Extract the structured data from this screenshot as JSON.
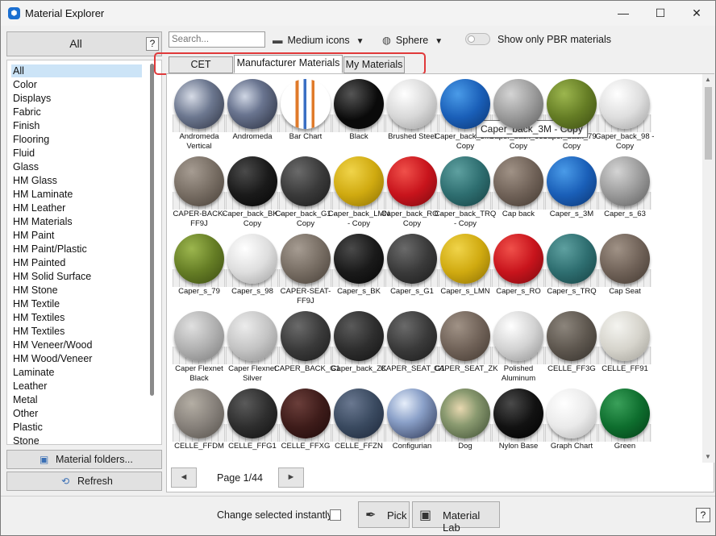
{
  "window": {
    "title": "Material Explorer",
    "logo_glyph": "⬢",
    "min_glyph": "—",
    "max_glyph": "☐",
    "close_glyph": "✕"
  },
  "left": {
    "header_label": "All",
    "help_label": "?",
    "categories": [
      "All",
      "Color",
      "Displays",
      "Fabric",
      "Finish",
      "Flooring",
      "Fluid",
      "Glass",
      "HM Glass",
      "HM Laminate",
      "HM Leather",
      "HM Materials",
      "HM Paint",
      "HM Paint/Plastic",
      "HM Painted",
      "HM Solid Surface",
      "HM Stone",
      "HM Textile",
      "HM Textiles",
      "HM Textiles",
      "HM Veneer/Wood",
      "HM Wood/Veneer",
      "Laminate",
      "Leather",
      "Metal",
      "Other",
      "Plastic",
      "Stone"
    ],
    "selected_category": "All",
    "folders_label": "Material folders...",
    "refresh_label": "Refresh"
  },
  "toolbar": {
    "search_placeholder": "Search...",
    "size_label": "Medium icons",
    "shape_label": "Sphere",
    "pbr_label": "Show only PBR materials",
    "pbr_on": false,
    "caret_glyph": "▼"
  },
  "tabs": [
    {
      "label": "CET Materials",
      "active": false
    },
    {
      "label": "Manufacturer Materials",
      "active": true
    },
    {
      "label": "My Materials",
      "active": false
    }
  ],
  "tooltip": "Caper_back_3M - Copy",
  "materials": [
    {
      "name": "Andromeda Vertical",
      "bg": "radial-gradient(circle at 35% 35%, #d6dbe6, #6d7890 45%, #2c3140)"
    },
    {
      "name": "Andromeda",
      "bg": "radial-gradient(circle at 35% 35%, #cfd6e4, #6a7590 40%, #262b3a)"
    },
    {
      "name": "Bar Chart",
      "bg": "linear-gradient(90deg, #fff 0 30%, #e07a2a 30% 36%, #fff 36% 46%, #3a6fc4 46% 52%, #fff 52% 62%, #e07a2a 62% 68%, #fff 68%)"
    },
    {
      "name": "Black",
      "bg": "radial-gradient(circle at 35% 30%, #555, #0a0a0a 55%)"
    },
    {
      "name": "Brushed Steel",
      "bg": "radial-gradient(circle at 35% 30%, #ffffff, #d8d8d8 50%, #9a9a9a)"
    },
    {
      "name": "Caper_back_3M - Copy",
      "bg": "radial-gradient(circle at 35% 30%, #4a9be8, #1a5fb8 50%, #0c3470)"
    },
    {
      "name": "Caper_back_63 - Copy",
      "bg": "radial-gradient(circle at 35% 30%, #d4d4d4, #9a9a9a 50%, #5c5c5c)"
    },
    {
      "name": "Caper_back_79 - Copy",
      "bg": "radial-gradient(circle at 35% 30%, #9cb64e, #657d25 50%, #3a4a12)"
    },
    {
      "name": "Caper_back_98 - Copy",
      "bg": "radial-gradient(circle at 35% 30%, #ffffff, #dedede 50%, #9e9e9e)"
    },
    {
      "name": "CAPER-BACK-FF9J",
      "bg": "radial-gradient(circle at 35% 30%, #a69c92, #776d63 50%, #463e37)"
    },
    {
      "name": "Caper_back_BK - Copy",
      "bg": "radial-gradient(circle at 35% 30%, #4a4a4a, #1a1a1a 50%, #050505)"
    },
    {
      "name": "Caper_back_G1 - Copy",
      "bg": "radial-gradient(circle at 35% 30%, #6a6a6a, #3a3a3a 50%, #1a1a1a)"
    },
    {
      "name": "Caper_back_LMN - Copy",
      "bg": "radial-gradient(circle at 35% 30%, #f0d44a, #d0aa10 50%, #8a6e05)"
    },
    {
      "name": "Caper_back_RO - Copy",
      "bg": "radial-gradient(circle at 35% 30%, #f0504a, #c8141c 50%, #7a0a10)"
    },
    {
      "name": "Caper_back_TRQ - Copy",
      "bg": "radial-gradient(circle at 35% 30%, #5ea0a0, #2e6e70 50%, #164042)"
    },
    {
      "name": "Cap back",
      "bg": "radial-gradient(circle at 35% 30%, #a09286, #706258 50%, #423830)"
    },
    {
      "name": "Caper_s_3M",
      "bg": "radial-gradient(circle at 35% 30%, #4a9be8, #1a5fb8 50%, #0c3470)"
    },
    {
      "name": "Caper_s_63",
      "bg": "radial-gradient(circle at 35% 30%, #d4d4d4, #9a9a9a 50%, #5c5c5c)"
    },
    {
      "name": "Caper_s_79",
      "bg": "radial-gradient(circle at 35% 30%, #9cb64e, #657d25 50%, #3a4a12)"
    },
    {
      "name": "Caper_s_98",
      "bg": "radial-gradient(circle at 35% 30%, #ffffff, #dedede 50%, #9e9e9e)"
    },
    {
      "name": "CAPER-SEAT-FF9J",
      "bg": "radial-gradient(circle at 35% 30%, #a69c92, #776d63 50%, #463e37)"
    },
    {
      "name": "Caper_s_BK",
      "bg": "radial-gradient(circle at 35% 30%, #4a4a4a, #1a1a1a 50%, #050505)"
    },
    {
      "name": "Caper_s_G1",
      "bg": "radial-gradient(circle at 35% 30%, #6a6a6a, #3a3a3a 50%, #1a1a1a)"
    },
    {
      "name": "Caper_s_LMN",
      "bg": "radial-gradient(circle at 35% 30%, #f0d44a, #d0aa10 50%, #8a6e05)"
    },
    {
      "name": "Caper_s_RO",
      "bg": "radial-gradient(circle at 35% 30%, #f0504a, #c8141c 50%, #7a0a10)"
    },
    {
      "name": "Caper_s_TRQ",
      "bg": "radial-gradient(circle at 35% 30%, #5ea0a0, #2e6e70 50%, #164042)"
    },
    {
      "name": "Cap Seat",
      "bg": "radial-gradient(circle at 35% 30%, #a09286, #706258 50%, #423830)"
    },
    {
      "name": "Caper Flexnet Black",
      "bg": "radial-gradient(circle at 35% 30%, #e0e0e0, #b0b0b0 50%, #7a7a7a)"
    },
    {
      "name": "Caper Flexnet Silver",
      "bg": "radial-gradient(circle at 35% 30%, #ececec, #c4c4c4 50%, #8c8c8c)"
    },
    {
      "name": "CAPER_BACK_G1",
      "bg": "radial-gradient(circle at 35% 30%, #6a6a6a, #3a3a3a 50%, #1a1a1a)"
    },
    {
      "name": "Caper_back_ZK",
      "bg": "radial-gradient(circle at 35% 30%, #5a5a5a, #2e2e2e 50%, #121212)"
    },
    {
      "name": "CAPER_SEAT_G1",
      "bg": "radial-gradient(circle at 35% 30%, #6a6a6a, #3a3a3a 50%, #1a1a1a)"
    },
    {
      "name": "CAPER_SEAT_ZK",
      "bg": "radial-gradient(circle at 35% 30%, #a09286, #706258 50%, #423830)"
    },
    {
      "name": "Polished Aluminum",
      "bg": "radial-gradient(circle at 35% 30%, #ffffff, #d2d2d2 50%, #8e8e8e)"
    },
    {
      "name": "CELLE_FF3G",
      "bg": "radial-gradient(circle at 35% 30%, #8c857c, #5e574f 50%, #34302b)"
    },
    {
      "name": "CELLE_FF91",
      "bg": "radial-gradient(circle at 35% 30%, #f4f4f0, #d6d4cc 50%, #a09e96)"
    },
    {
      "name": "CELLE_FFDM",
      "bg": "radial-gradient(circle at 35% 30%, #b4aea4, #86807a 50%, #54504a)"
    },
    {
      "name": "CELLE_FFG1",
      "bg": "radial-gradient(circle at 35% 30%, #5a5a5a, #2e2e2e 50%, #101010)"
    },
    {
      "name": "CELLE_FFXG",
      "bg": "radial-gradient(circle at 35% 30%, #6a3e3a, #3e1c1a 50%, #1e0a0a)"
    },
    {
      "name": "CELLE_FFZN",
      "bg": "radial-gradient(circle at 35% 30%, #6a7890, #3a4a60 50%, #1c2638)"
    },
    {
      "name": "Configurian",
      "bg": "radial-gradient(circle at 35% 30%, #e6eefa, #8aa0c8 40%, #2a3350)"
    },
    {
      "name": "Dog",
      "bg": "radial-gradient(circle at 40% 40%, #e8d8b0, #8a9a70 40%, #3a4a30)"
    },
    {
      "name": "Nylon Base",
      "bg": "radial-gradient(circle at 35% 30%, #4a4a4a, #121212 50%, #000000)"
    },
    {
      "name": "Graph Chart",
      "bg": "radial-gradient(circle at 35% 30%, #ffffff, #eaeaea 50%, #b0b0b0)"
    },
    {
      "name": "Green",
      "bg": "radial-gradient(circle at 35% 30%, #3aa05a, #0e6e2e 50%, #043c16)"
    }
  ],
  "pager": {
    "prev_glyph": "◄",
    "next_glyph": "►",
    "label": "Page 1/44"
  },
  "bottom": {
    "instant_label": "Change selected instantly:",
    "pick_label": "Pick",
    "pick_glyph": "✒",
    "lab_label": "Material Lab",
    "lab_glyph": "▣",
    "help_label": "?"
  }
}
